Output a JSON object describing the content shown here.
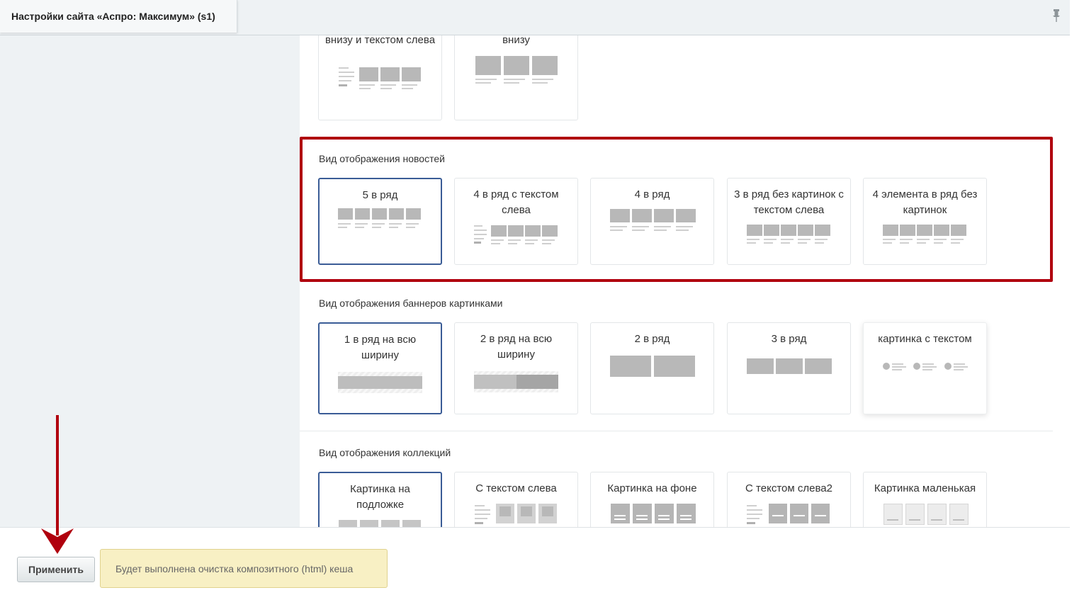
{
  "header": {
    "title": "Настройки сайта «Аспро: Максимум» (s1)"
  },
  "top_partial": {
    "cards": [
      {
        "label": "внизу и текстом слева"
      },
      {
        "label": "внизу"
      }
    ]
  },
  "news_section": {
    "title": "Вид отображения новостей",
    "options": [
      {
        "label": "5 в ряд",
        "selected": true
      },
      {
        "label": "4 в ряд с текстом слева",
        "selected": false
      },
      {
        "label": "4 в ряд",
        "selected": false
      },
      {
        "label": "3 в ряд без картинок с текстом слева",
        "selected": false
      },
      {
        "label": "4 элемента в ряд без картинок",
        "selected": false
      }
    ]
  },
  "banners_section": {
    "title": "Вид отображения баннеров картинками",
    "options": [
      {
        "label": "1 в ряд на всю ширину",
        "selected": true
      },
      {
        "label": "2 в ряд на всю ширину",
        "selected": false
      },
      {
        "label": "2 в ряд",
        "selected": false
      },
      {
        "label": "3 в ряд",
        "selected": false
      },
      {
        "label": "картинка с текстом",
        "selected": false
      }
    ]
  },
  "collections_section": {
    "title": "Вид отображения коллекций",
    "options": [
      {
        "label": "Картинка на подложке",
        "selected": true
      },
      {
        "label": "С текстом слева",
        "selected": false
      },
      {
        "label": "Картинка на фоне",
        "selected": false
      },
      {
        "label": "С текстом слева2",
        "selected": false
      },
      {
        "label": "Картинка маленькая",
        "selected": false
      }
    ]
  },
  "footer": {
    "apply_label": "Применить",
    "notice_text": "Будет выполнена очистка композитного (html) кеша"
  },
  "colors": {
    "selected_border": "#3a5c96",
    "highlight": "#b0000e",
    "notice_bg": "#f8f0c4"
  },
  "icons": [
    "pin-icon",
    "arrow-annotation"
  ]
}
